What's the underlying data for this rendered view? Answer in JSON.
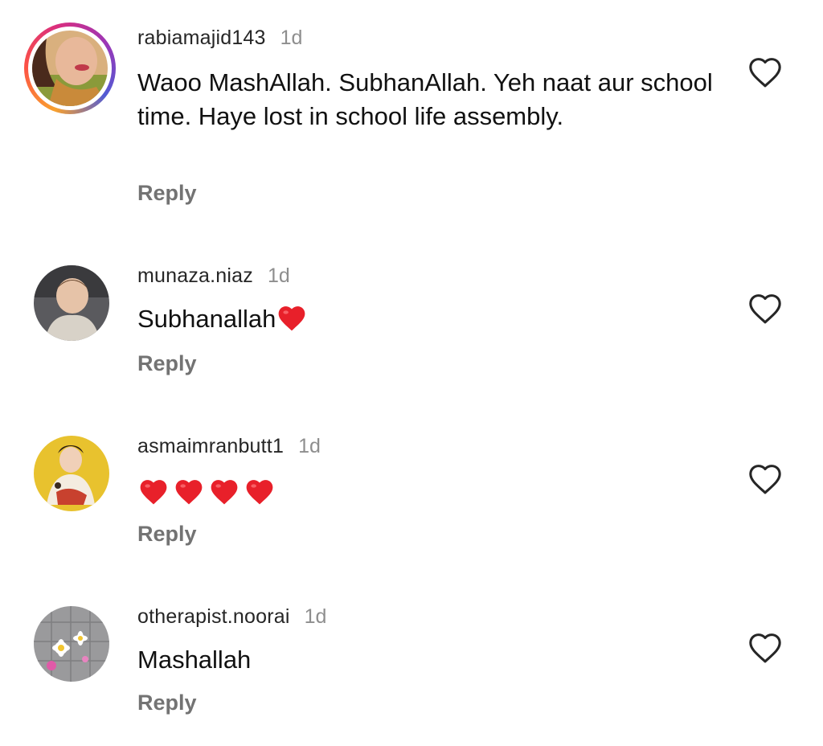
{
  "comments": [
    {
      "username": "rabiamajid143",
      "time": "1d",
      "text": "Waoo MashAllah. SubhanAllah. Yeh naat aur school time. Haye lost in school life assembly.",
      "reply_label": "Reply",
      "avatar": "profile-photo-avatar",
      "has_story_ring": true
    },
    {
      "username": "munaza.niaz",
      "time": "1d",
      "text": "Subhanallah",
      "reply_label": "Reply",
      "avatar": "child-photo-avatar"
    },
    {
      "username": "asmaimranbutt1",
      "time": "1d",
      "text": "",
      "hearts_count": 4,
      "reply_label": "Reply",
      "avatar": "illustrated-woman-avatar"
    },
    {
      "username": "otherapist.noorai",
      "time": "1d",
      "text": "Mashallah",
      "reply_label": "Reply",
      "avatar": "daisy-flowers-avatar"
    }
  ],
  "colors": {
    "username": "#262626",
    "timestamp": "#8e8e8e",
    "reply": "#737373",
    "heart_emoji": "#e8202a",
    "like_outline": "#262626"
  }
}
